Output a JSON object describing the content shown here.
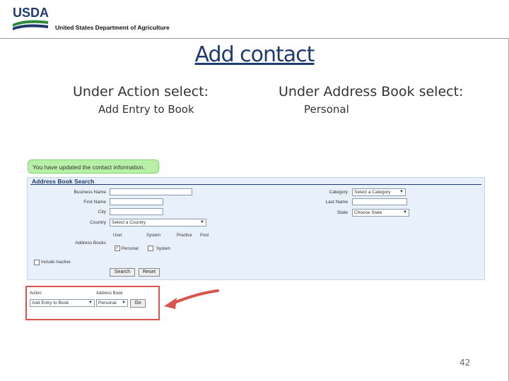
{
  "header": {
    "logo_text": "USDA",
    "department": "United States Department of Agriculture"
  },
  "title": "Add contact",
  "columns": {
    "left_heading": "Under Action select:",
    "left_value": "Add Entry to Book",
    "right_heading": "Under Address Book select:",
    "right_value": "Personal"
  },
  "screenshot": {
    "success_message": "You have updated the contact information.",
    "panel_title": "Address Book Search",
    "fields": {
      "business_name_label": "Business Name",
      "first_name_label": "First Name",
      "city_label": "City",
      "country_label": "Country",
      "country_value": "Select a Country",
      "address_books_label": "Address Books",
      "category_label": "Category",
      "category_value": "Select a Category",
      "last_name_label": "Last Name",
      "state_label": "State",
      "state_value": "Choose State"
    },
    "book_columns": [
      "User",
      "System",
      "Practice",
      "Pool"
    ],
    "book_options": {
      "personal_label": "Personal",
      "system_label": "System"
    },
    "include_inactive_label": "Include Inactive",
    "buttons": {
      "search": "Search",
      "reset": "Reset"
    },
    "action_bar": {
      "action_label": "Action",
      "action_value": "Add Entry to Book",
      "address_book_label": "Address Book",
      "address_book_value": "Personal",
      "go_label": "Go"
    }
  },
  "colors": {
    "usda_blue": "#1f3a6e",
    "usda_green": "#2e8b3d",
    "success_bg": "#b8f0a8",
    "panel_bg": "#e8f1fb",
    "highlight_red": "#d9534f"
  },
  "page_number": "42"
}
